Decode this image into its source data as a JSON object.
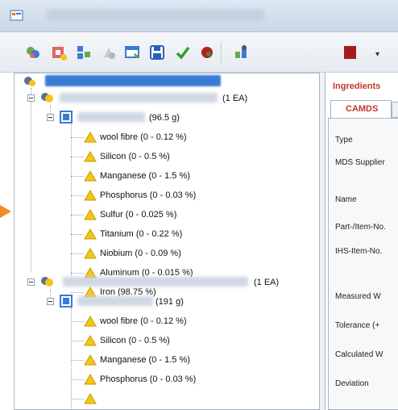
{
  "toolbar": {
    "icons": [
      "materials-icon",
      "add-component-icon",
      "tree-icon",
      "disabled-icon",
      "window-icon",
      "save-icon",
      "check-icon",
      "record-icon",
      "user-icon",
      "book-icon"
    ],
    "dropdown_glyph": "▾"
  },
  "tree": {
    "nodes": [
      {
        "label": "(1 EA)"
      },
      {
        "label": "(96.5 g)"
      },
      {
        "label": "wool fibre (0 - 0.12 %)"
      },
      {
        "label": "Silicon (0 - 0.5 %)"
      },
      {
        "label": "Manganese (0 - 1.5 %)"
      },
      {
        "label": "Phosphorus (0 - 0.03 %)"
      },
      {
        "label": "Sulfur (0 - 0.025 %)"
      },
      {
        "label": "Titanium (0 - 0.22 %)"
      },
      {
        "label": "Niobium (0 - 0.09 %)"
      },
      {
        "label": "Aluminum (0 - 0.015 %)"
      },
      {
        "label": "Iron (98.75 %)"
      },
      {
        "label": "(1 EA)"
      },
      {
        "label": "(191 g)"
      },
      {
        "label": "wool fibre (0 - 0.12 %)"
      },
      {
        "label": "Silicon (0 - 0.5 %)"
      },
      {
        "label": "Manganese (0 - 1.5 %)"
      },
      {
        "label": "Phosphorus (0 - 0.03 %)"
      }
    ]
  },
  "right_panel": {
    "title": "Ingredients",
    "tab_label": "CAMDS",
    "fields": [
      "Type",
      "MDS Supplier",
      "Name",
      "Part-/Item-No.",
      "IHS-Item-No.",
      "Measured W",
      "Tolerance (+",
      "Calculated W",
      "Deviation"
    ]
  },
  "colors": {
    "accent_red": "#c0392b",
    "selection_blue": "#3a7bd5",
    "warning_yellow": "#f5c518",
    "arrow_orange": "#f08a24"
  }
}
